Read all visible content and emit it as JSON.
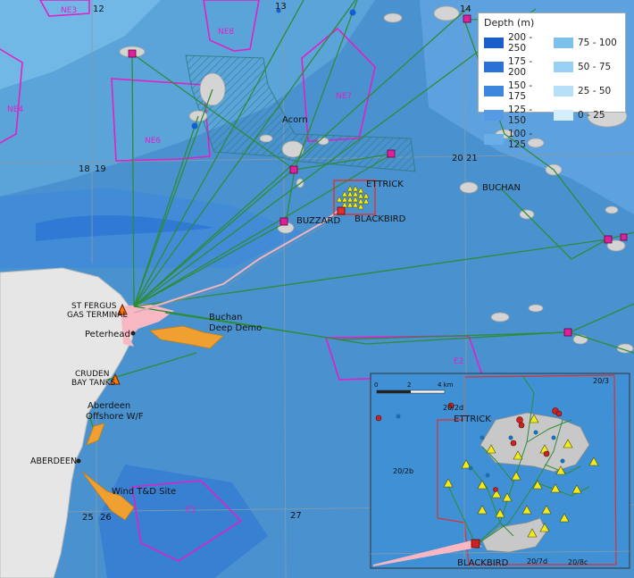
{
  "legend": {
    "title": "Depth (m)",
    "items": [
      {
        "label": "200 - 250",
        "color": "#1a5fc9"
      },
      {
        "label": "75 - 100",
        "color": "#7cc0ee"
      },
      {
        "label": "175 - 200",
        "color": "#2a72d6"
      },
      {
        "label": "50 - 75",
        "color": "#97d0f3"
      },
      {
        "label": "150 - 175",
        "color": "#3d86de"
      },
      {
        "label": "25 - 50",
        "color": "#b5e0f7"
      },
      {
        "label": "125 - 150",
        "color": "#559ae3"
      },
      {
        "label": "0 - 25",
        "color": "#d4eefb"
      },
      {
        "label": "100 - 125",
        "color": "#6aaee8"
      }
    ]
  },
  "grid_labels": {
    "ne3": "NE3",
    "n12": "12",
    "n13": "13",
    "n14": "14",
    "ne8": "NE8",
    "ne4": "NE4",
    "ne6": "NE6",
    "ne7": "NE7",
    "n18": "18",
    "n19": "19",
    "n20": "20",
    "n21": "21",
    "e2": "E2",
    "e3": "E3",
    "n25": "25",
    "n26": "26",
    "n27": "27"
  },
  "field_labels": {
    "acorn": "Acorn",
    "ettrick": "ETTRICK",
    "buzzard": "BUZZARD",
    "blackbird": "BLACKBIRD",
    "buchan": "BUCHAN"
  },
  "onshore_labels": {
    "st_fergus_1": "ST FERGUS",
    "st_fergus_2": "GAS TERMINAL",
    "peterhead": "Peterhead",
    "buchan_demo_1": "Buchan",
    "buchan_demo_2": "Deep Demo",
    "cruden_1": "CRUDEN",
    "cruden_2": "BAY TANKS",
    "aberdeen_wf_1": "Aberdeen",
    "aberdeen_wf_2": "Offshore W/F",
    "aberdeen": "ABERDEEN",
    "wind_td": "Wind T&D Site"
  },
  "inset": {
    "scale_labels": [
      "0",
      "2",
      "4 km"
    ],
    "block_labels": {
      "b20_2d": "20/2d",
      "b20_2b": "20/2b",
      "b20_3": "20/3",
      "b20_7d": "20/7d",
      "b20_8c": "20/8c"
    },
    "ettrick": "ETTRICK",
    "blackbird": "BLACKBIRD"
  },
  "colors": {
    "land": "#e6e6e6",
    "pipeline": "#2e8b3a",
    "licence": "#e020c8",
    "platform": "#e0209a",
    "terminal": "#ff7a00",
    "wind_site": "#f0a030"
  }
}
